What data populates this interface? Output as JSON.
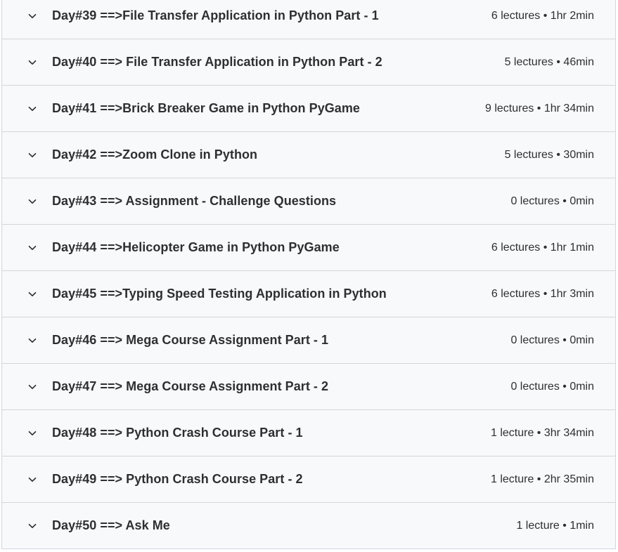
{
  "sections": [
    {
      "title": "Day#39 ==>File Transfer Application in Python Part - 1",
      "meta": "6 lectures • 1hr 2min"
    },
    {
      "title": "Day#40 ==> File Transfer Application in Python Part - 2",
      "meta": "5 lectures • 46min"
    },
    {
      "title": "Day#41 ==>Brick Breaker Game in Python PyGame",
      "meta": "9 lectures • 1hr 34min"
    },
    {
      "title": "Day#42 ==>Zoom Clone in Python",
      "meta": "5 lectures • 30min"
    },
    {
      "title": "Day#43 ==> Assignment - Challenge Questions",
      "meta": "0 lectures • 0min"
    },
    {
      "title": "Day#44 ==>Helicopter Game in Python PyGame",
      "meta": "6 lectures • 1hr 1min"
    },
    {
      "title": "Day#45 ==>Typing Speed Testing Application in Python",
      "meta": "6 lectures • 1hr 3min"
    },
    {
      "title": "Day#46 ==> Mega Course Assignment Part - 1",
      "meta": "0 lectures • 0min"
    },
    {
      "title": "Day#47 ==> Mega Course Assignment Part - 2",
      "meta": "0 lectures • 0min"
    },
    {
      "title": "Day#48 ==> Python Crash Course Part - 1",
      "meta": "1 lecture • 3hr 34min"
    },
    {
      "title": "Day#49 ==> Python Crash Course Part - 2",
      "meta": "1 lecture • 2hr 35min"
    },
    {
      "title": "Day#50 ==> Ask Me",
      "meta": "1 lecture • 1min"
    }
  ],
  "icons": {
    "expand": "chevron-down-icon"
  },
  "colors": {
    "text": "#2d2f31",
    "row_background": "#f7f9fa",
    "border": "#d1d7dc"
  }
}
